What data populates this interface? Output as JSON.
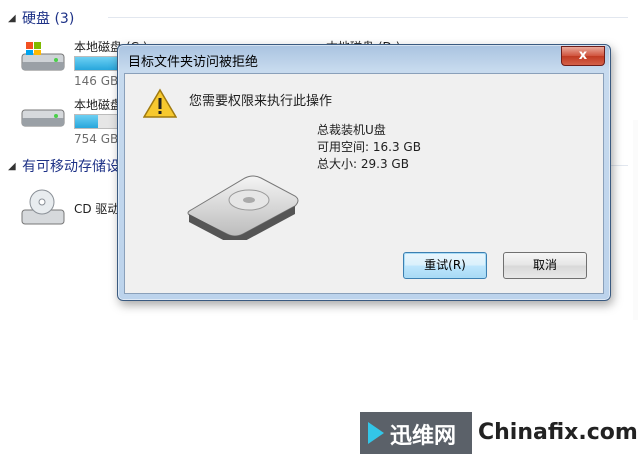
{
  "explorer": {
    "hard_disks_header": "硬盘 (3)",
    "removable_header": "有可移动存储设",
    "drives": [
      {
        "name": "本地磁盘 (C:)",
        "size": "146 GB",
        "usage": 0.45
      },
      {
        "name": "本地磁盘 (D:)"
      },
      {
        "name": "本地磁盘",
        "size": "754 GB",
        "usage": 0.12
      }
    ],
    "cd": {
      "name": "CD 驱动"
    }
  },
  "dialog": {
    "title": "目标文件夹访问被拒绝",
    "close_label": "x",
    "message": "您需要权限来执行此操作",
    "device_name": "总裁装机U盘",
    "free_space": "可用空间: 16.3 GB",
    "total_size": "总大小: 29.3 GB",
    "retry_label": "重试(R)",
    "cancel_label": "取消"
  },
  "watermark": {
    "brand_cn": "迅维网",
    "brand_en": "Chinafix.com"
  },
  "colors": {
    "accent": "#1e3287",
    "progress": "#27a6dc",
    "dialog_frame": "#bcd3ec"
  }
}
